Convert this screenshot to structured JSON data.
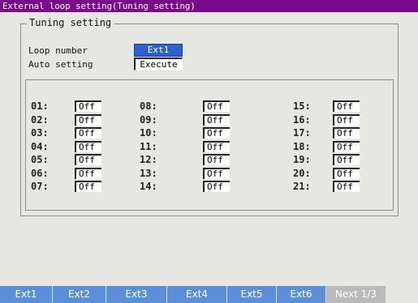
{
  "window": {
    "title": "External loop setting(Tuning setting)"
  },
  "group": {
    "title": "Tuning setting"
  },
  "settings": {
    "loop_number_label": "Loop number",
    "loop_number_value": "Ext1",
    "auto_setting_label": "Auto setting",
    "auto_setting_value": "Execute"
  },
  "table": {
    "columns": [
      [
        {
          "num": "01:",
          "value": "Off"
        },
        {
          "num": "02:",
          "value": "Off"
        },
        {
          "num": "03:",
          "value": "Off"
        },
        {
          "num": "04:",
          "value": "Off"
        },
        {
          "num": "05:",
          "value": "Off"
        },
        {
          "num": "06:",
          "value": "Off"
        },
        {
          "num": "07:",
          "value": "Off"
        }
      ],
      [
        {
          "num": "08:",
          "value": "Off"
        },
        {
          "num": "09:",
          "value": "Off"
        },
        {
          "num": "10:",
          "value": "Off"
        },
        {
          "num": "11:",
          "value": "Off"
        },
        {
          "num": "12:",
          "value": "Off"
        },
        {
          "num": "13:",
          "value": "Off"
        },
        {
          "num": "14:",
          "value": "Off"
        }
      ],
      [
        {
          "num": "15:",
          "value": "Off"
        },
        {
          "num": "16:",
          "value": "Off"
        },
        {
          "num": "17:",
          "value": "Off"
        },
        {
          "num": "18:",
          "value": "Off"
        },
        {
          "num": "19:",
          "value": "Off"
        },
        {
          "num": "20:",
          "value": "Off"
        },
        {
          "num": "21:",
          "value": "Off"
        }
      ]
    ]
  },
  "softkeys": [
    "Ext1",
    "Ext2",
    "Ext3",
    "Ext4",
    "Ext5",
    "Ext6",
    "Next 1/3"
  ],
  "colors": {
    "title_bar": "#7a0a8c",
    "selected_field": "#2e5fcb",
    "softkey": "#5b8fd7",
    "softkey_next": "#b9b9b9"
  }
}
